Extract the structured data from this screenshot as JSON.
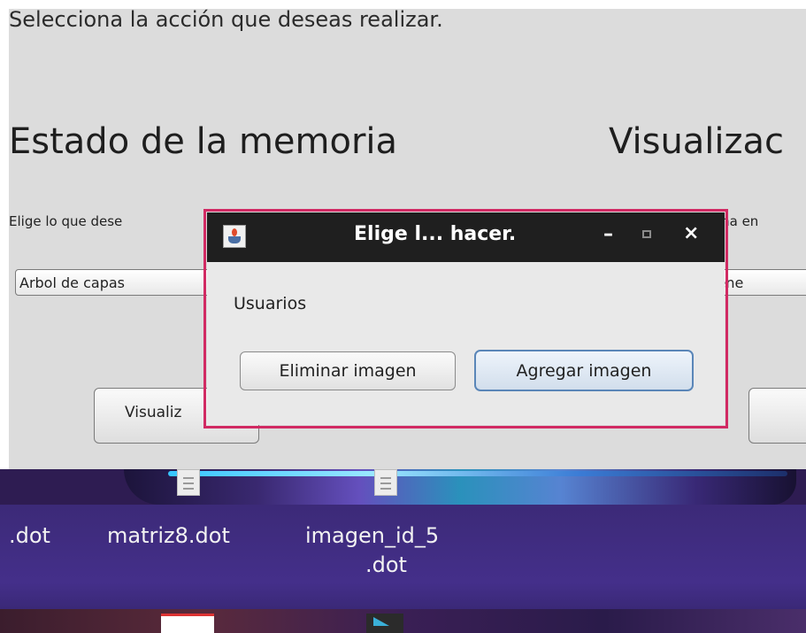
{
  "main_window": {
    "instruction": "Selecciona la acción que deseas realizar.",
    "memory_heading": "Estado de la memoria",
    "visualize_heading": "Visualizac",
    "memory_label": "Elige lo que dese",
    "visualize_label": "ma en",
    "memory_combo_value": "Arbol de capas",
    "visualize_combo_value": "magene",
    "visualize_button_label": "Visualiz"
  },
  "dialog": {
    "title": "Elige l... hacer.",
    "minimize_glyph": "–",
    "close_glyph": "×",
    "message": "Usuarios",
    "delete_button": "Eliminar imagen",
    "add_button": "Agregar imagen",
    "focus_highlight_color": "#d12a63"
  },
  "desktop": {
    "file1_label": ".dot",
    "file2_label": "matriz8.dot",
    "file3_label": "imagen_id_5",
    "file3_label_line2": ".dot"
  }
}
